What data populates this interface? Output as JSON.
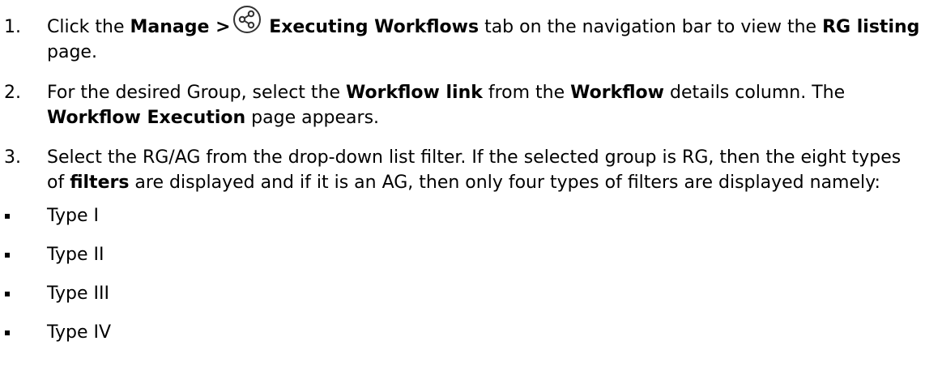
{
  "steps": [
    {
      "num": "1.",
      "parts": {
        "a": "Click the ",
        "b": "Manage >",
        "icon": "workflow-share-icon",
        "c": " Executing Workflows",
        "d": " tab on the navigation bar to view the ",
        "e": "RG listing",
        "f": " page."
      }
    },
    {
      "num": "2.",
      "parts": {
        "a": "For the desired Group, select the ",
        "b": "Workflow link",
        "c": " from the ",
        "d": "Workflow",
        "e": " details column. The ",
        "f": "Workflow Execution",
        "g": " page appears."
      }
    },
    {
      "num": "3.",
      "parts": {
        "a": "Select the RG/AG from the drop-down list filter. If the selected group is RG, then the eight types of ",
        "b": "filters",
        "c": " are displayed and if it is an AG, then only four types of filters are displayed namely:"
      }
    }
  ],
  "filter_types": [
    "Type I",
    "Type II",
    "Type III",
    "Type IV"
  ]
}
